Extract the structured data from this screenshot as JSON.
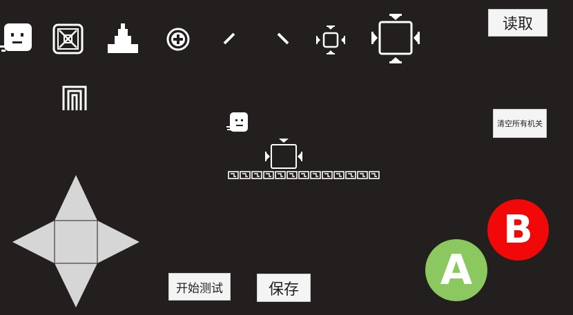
{
  "toolbar": {
    "tools": [
      {
        "name": "player-block-tool",
        "icon": "player-face-icon"
      },
      {
        "name": "crate-tool",
        "icon": "crate-x-icon"
      },
      {
        "name": "spike-tool",
        "icon": "spike-pyramid-icon"
      },
      {
        "name": "coin-tool",
        "icon": "plus-coin-icon"
      },
      {
        "name": "slash-forward-tool",
        "icon": "diagonal-slash-icon"
      },
      {
        "name": "slash-back-tool",
        "icon": "diagonal-backslash-icon"
      },
      {
        "name": "small-mechanism-tool",
        "icon": "small-arrow-box-icon"
      },
      {
        "name": "large-mechanism-tool",
        "icon": "large-arrow-box-icon"
      },
      {
        "name": "door-tool",
        "icon": "door-arch-icon"
      }
    ]
  },
  "buttons": {
    "load": "读取",
    "clear_mechanisms": "清空所有机关",
    "start_test": "开始测试",
    "save": "保存",
    "a": "A",
    "b": "B"
  },
  "colors": {
    "background": "#221f1e",
    "dpad": "#d6d6d6",
    "button_a": "#8bc860",
    "button_b": "#f20808"
  },
  "level": {
    "floor_tile_count": 13
  }
}
